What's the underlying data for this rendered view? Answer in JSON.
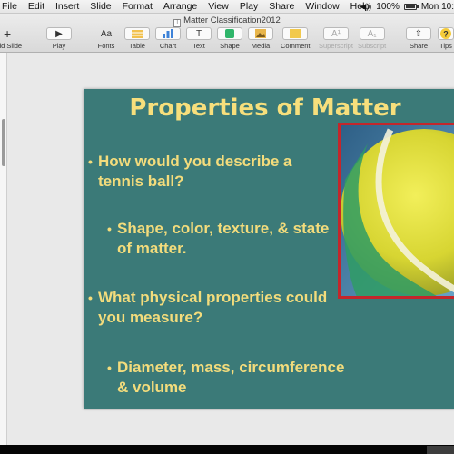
{
  "menubar": {
    "items": [
      "File",
      "Edit",
      "Insert",
      "Slide",
      "Format",
      "Arrange",
      "View",
      "Play",
      "Share",
      "Window",
      "Help"
    ],
    "volume_icon": "volume-icon",
    "battery": "100%",
    "clock": "Mon 10:"
  },
  "toolbar": {
    "document_title": "Matter Classification2012",
    "tools": [
      {
        "label": "Add Slide",
        "icon": "plus-icon",
        "glyph": "+"
      },
      {
        "label": "Play",
        "icon": "play-icon",
        "glyph": "▶"
      },
      {
        "label": "Fonts",
        "icon": "fonts-icon",
        "glyph": "Aa"
      },
      {
        "label": "Table",
        "icon": "table-icon",
        "glyph": ""
      },
      {
        "label": "Chart",
        "icon": "chart-icon",
        "glyph": ""
      },
      {
        "label": "Text",
        "icon": "text-icon",
        "glyph": "T"
      },
      {
        "label": "Shape",
        "icon": "shape-icon",
        "glyph": ""
      },
      {
        "label": "Media",
        "icon": "media-icon",
        "glyph": ""
      },
      {
        "label": "Comment",
        "icon": "comment-icon",
        "glyph": ""
      },
      {
        "label": "Superscript",
        "icon": "superscript-icon",
        "glyph": "A¹"
      },
      {
        "label": "Subscript",
        "icon": "subscript-icon",
        "glyph": "A₁"
      },
      {
        "label": "Share",
        "icon": "share-icon",
        "glyph": "⇧"
      },
      {
        "label": "Tips",
        "icon": "tips-icon",
        "glyph": "?"
      }
    ],
    "colors": {
      "table": "#f2c14e",
      "chart": "#3d82d8",
      "shape": "#2fb56a",
      "media": "#e8b54a",
      "comment": "#f2c94c",
      "tips": "#f5cc3c"
    }
  },
  "slide": {
    "title": "Properties of Matter",
    "bullets": [
      {
        "text": "How would you describe a tennis ball?",
        "level": 1
      },
      {
        "text": "Shape, color, texture, & state of matter.",
        "level": 2
      },
      {
        "text": "What physical properties could you measure?",
        "level": 1
      },
      {
        "text": "Diameter, mass, circumference & volume",
        "level": 2
      }
    ],
    "image": "tennis-ball-photo",
    "colors": {
      "background": "#3b7a78",
      "text": "#f3dc7c",
      "frame": "#c4262b"
    }
  }
}
